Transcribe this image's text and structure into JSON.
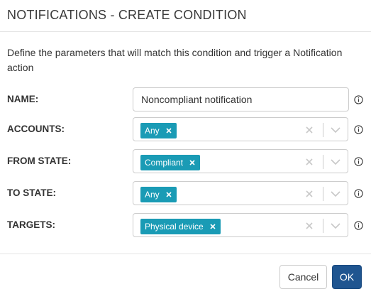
{
  "dialog": {
    "title": "NOTIFICATIONS - CREATE CONDITION",
    "description": "Define the parameters that will match this condition and trigger a Notification action"
  },
  "fields": {
    "name": {
      "label": "NAME:",
      "value": "Noncompliant notification"
    },
    "accounts": {
      "label": "ACCOUNTS:",
      "chip": "Any"
    },
    "from_state": {
      "label": "FROM STATE:",
      "chip": "Compliant"
    },
    "to_state": {
      "label": "TO STATE:",
      "chip": "Any"
    },
    "targets": {
      "label": "TARGETS:",
      "chip": "Physical device"
    }
  },
  "buttons": {
    "cancel": "Cancel",
    "ok": "OK"
  },
  "icons": {
    "chip_remove": "close-icon",
    "clear": "clear-icon",
    "dropdown": "chevron-down-icon",
    "info": "info-icon"
  },
  "colors": {
    "chip_bg": "#1a9bb5",
    "primary_button": "#1f5590",
    "border": "#cccccc",
    "muted_icon": "#c8c8c8"
  }
}
